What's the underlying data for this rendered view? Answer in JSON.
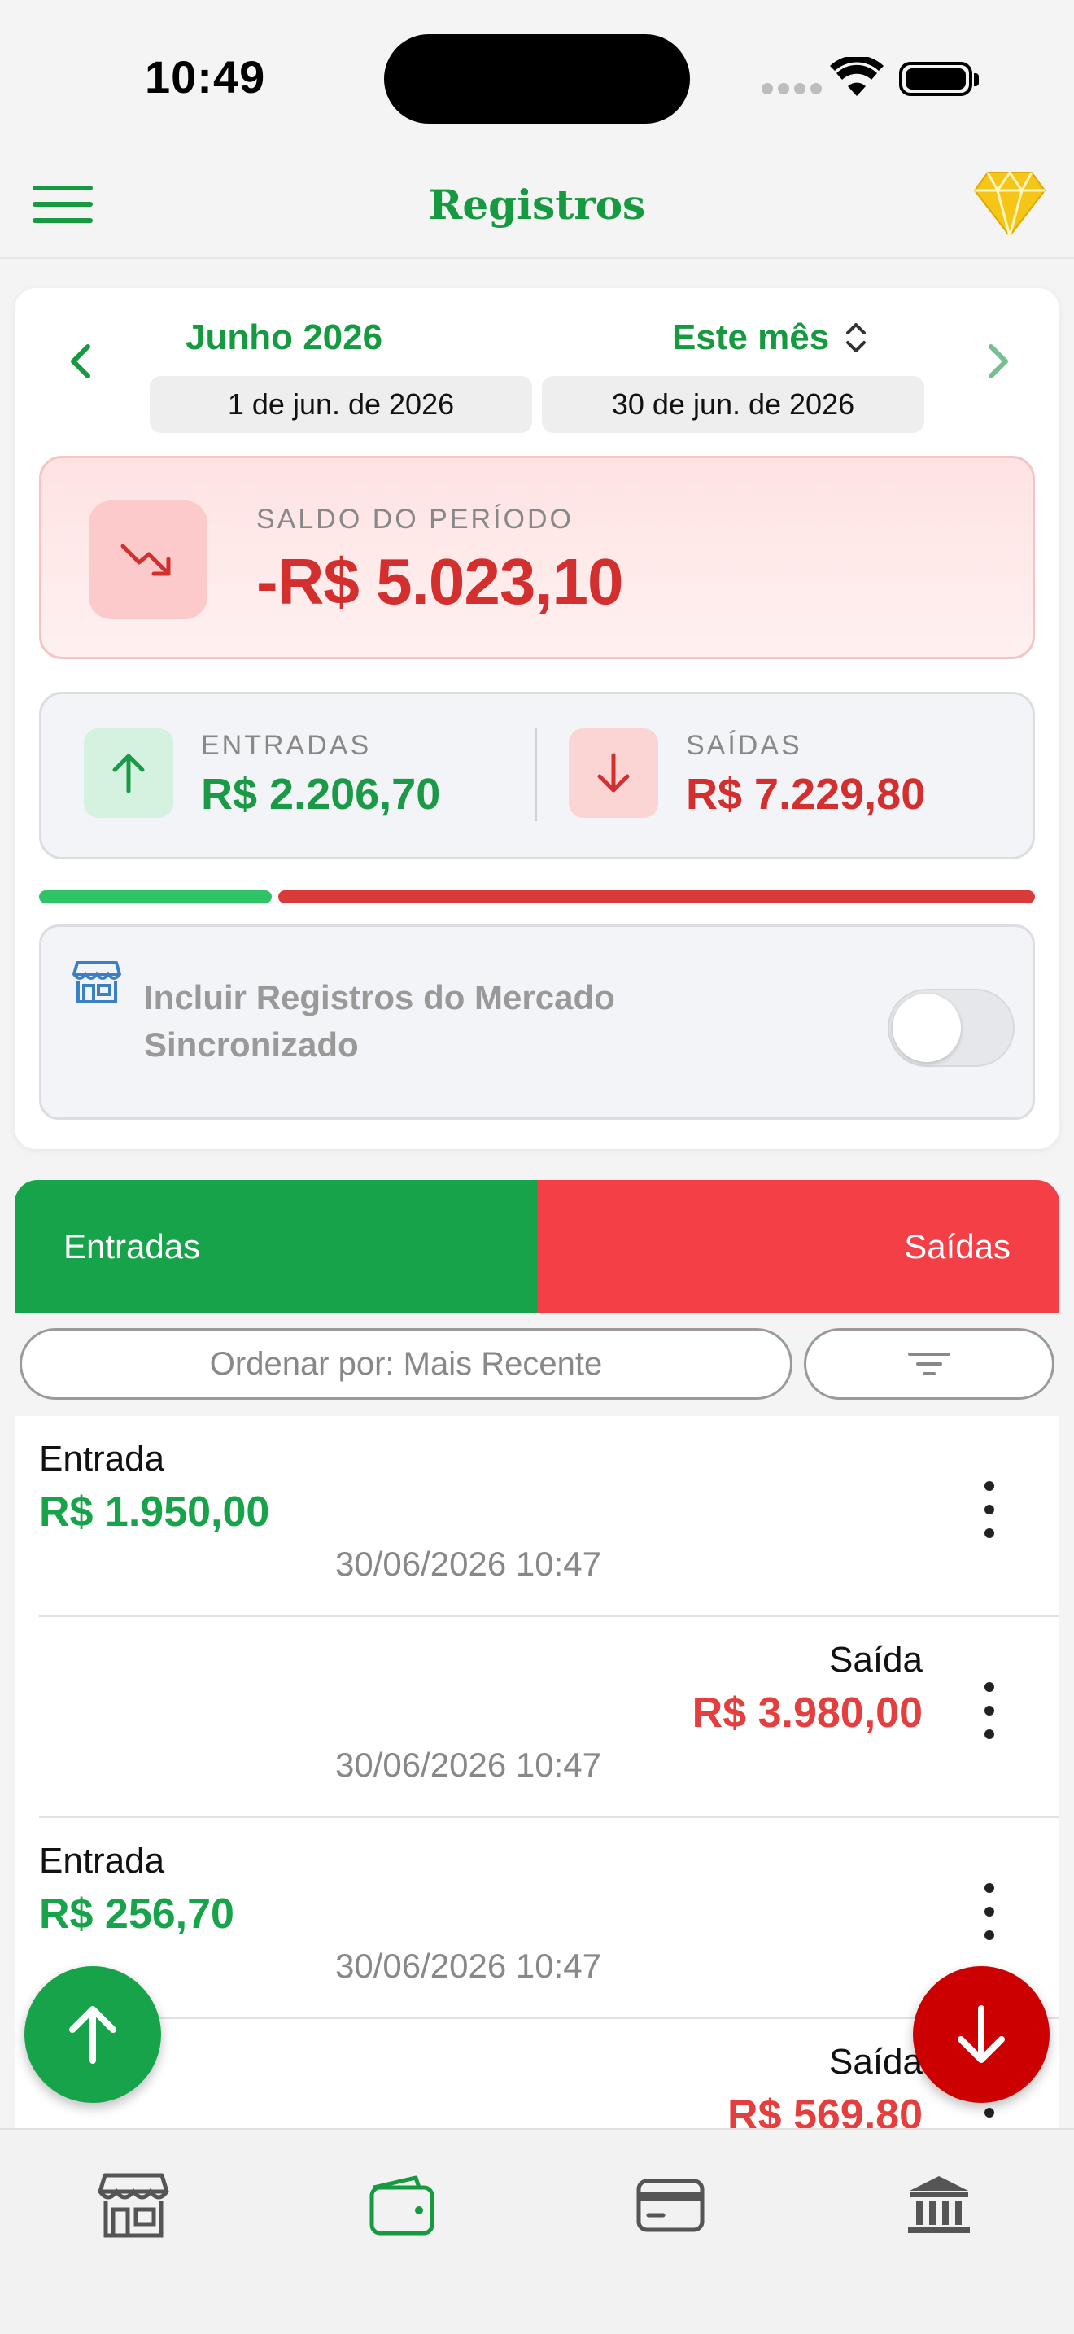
{
  "status_bar": {
    "time": "10:49"
  },
  "header": {
    "title": "Registros"
  },
  "period": {
    "month": "Junho 2026",
    "range_selector": "Este mês",
    "start_date": "1 de jun. de 2026",
    "end_date": "30 de jun. de 2026"
  },
  "balance": {
    "label": "SALDO DO PERÍODO",
    "value": "-R$ 5.023,10"
  },
  "flows": {
    "in_label": "ENTRADAS",
    "in_value": "R$ 2.206,70",
    "out_label": "SAÍDAS",
    "out_value": "R$ 7.229,80",
    "in_share": 0.234
  },
  "sync": {
    "label": "Incluir Registros do Mercado Sincronizado",
    "enabled": false
  },
  "tabs": {
    "in": "Entradas",
    "out": "Saídas"
  },
  "sort": {
    "label": "Ordenar por: Mais Recente"
  },
  "records": [
    {
      "kind": "in",
      "type": "Entrada",
      "amount": "R$ 1.950,00",
      "date": "30/06/2026 10:47"
    },
    {
      "kind": "out",
      "type": "Saída",
      "amount": "R$ 3.980,00",
      "date": "30/06/2026 10:47"
    },
    {
      "kind": "in",
      "type": "Entrada",
      "amount": "R$ 256,70",
      "date": "30/06/2026 10:47"
    },
    {
      "kind": "out",
      "type": "Saída",
      "amount": "R$ 569,80",
      "date": ""
    }
  ],
  "colors": {
    "accent_green": "#16a34a",
    "accent_red": "#d32f2f",
    "gem_yellow": "#f5c518"
  },
  "tabbar": {
    "items": [
      "store-icon",
      "wallet-icon",
      "card-icon",
      "bank-icon"
    ],
    "active": "wallet-icon"
  }
}
